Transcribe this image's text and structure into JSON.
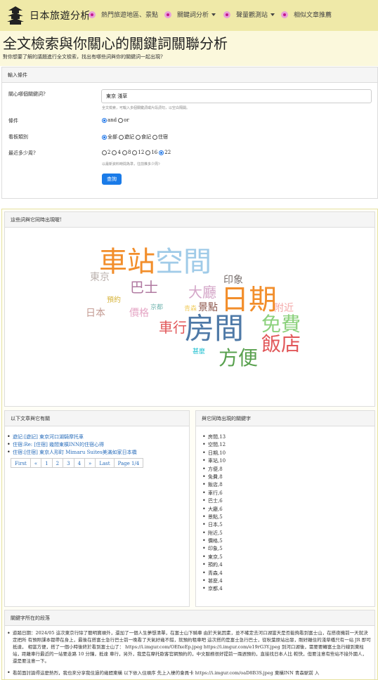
{
  "nav": {
    "brand": "日本旅遊分析",
    "items": [
      {
        "label": "熱門旅遊地區、景點",
        "dropdown": false
      },
      {
        "label": "關鍵詞分析",
        "dropdown": true
      },
      {
        "label": "聲量觀測站",
        "dropdown": true
      },
      {
        "label": "相似文章推薦",
        "dropdown": false
      }
    ]
  },
  "header": {
    "title": "全文檢索與你關心的關鍵詞關聯分析",
    "subtitle": "對你想要了解的議題進行全文檢索，找出有哪些詞與你的關鍵詞一起出現?"
  },
  "form": {
    "panel_title": "輸入條件",
    "keyword_label": "關心哪個關鍵詞?",
    "keyword_value": "東京 淺草",
    "keyword_help": "全文檢索，可輸入多個關鍵詞或片段詞句，以空白隔開。",
    "cond_label": "條件",
    "cond_options": [
      {
        "label": "and",
        "checked": true
      },
      {
        "label": "or",
        "checked": false
      }
    ],
    "board_label": "看板類別",
    "board_options": [
      {
        "label": "全部",
        "checked": true
      },
      {
        "label": "遊記",
        "checked": false
      },
      {
        "label": "食記",
        "checked": false
      },
      {
        "label": "住宿",
        "checked": false
      }
    ],
    "weeks_label": "最近多少周?",
    "weeks_options": [
      {
        "label": "2",
        "checked": false
      },
      {
        "label": "4",
        "checked": false
      },
      {
        "label": "8",
        "checked": false
      },
      {
        "label": "12",
        "checked": false
      },
      {
        "label": "16",
        "checked": false
      },
      {
        "label": "22",
        "checked": true
      }
    ],
    "weeks_help": "以最新資料時間為準，往前推多少周?",
    "submit_label": "查詢"
  },
  "cloud": {
    "panel_title": "這些詞與它同時出現喔!",
    "words": [
      {
        "text": "車站",
        "color": "#f28e2b"
      },
      {
        "text": "空間",
        "color": "#a0cbe8"
      },
      {
        "text": "東京",
        "color": "#bab0ac"
      },
      {
        "text": "巴士",
        "color": "#b07aa1"
      },
      {
        "text": "印象",
        "color": "#79706e"
      },
      {
        "text": "大廳",
        "color": "#d4a6c8"
      },
      {
        "text": "預約",
        "color": "#d7b53e"
      },
      {
        "text": "京都",
        "color": "#76b7b2"
      },
      {
        "text": "景點",
        "color": "#8c564b"
      },
      {
        "text": "日期",
        "color": "#f28e2b"
      },
      {
        "text": "附近",
        "color": "#f4a8a8"
      },
      {
        "text": "日本",
        "color": "#c49c94"
      },
      {
        "text": "價格",
        "color": "#e5a6c5"
      },
      {
        "text": "青森",
        "color": "#f1ce63"
      },
      {
        "text": "車行",
        "color": "#e15759"
      },
      {
        "text": "房間",
        "color": "#4e79a7"
      },
      {
        "text": "免費",
        "color": "#8cd17d"
      },
      {
        "text": "飯店",
        "color": "#e15759"
      },
      {
        "text": "甚麼",
        "color": "#17becf"
      },
      {
        "text": "方便",
        "color": "#59a14f"
      }
    ]
  },
  "articles": {
    "panel_title": "以下文章與它有關",
    "items": [
      "遊記:[遊記] 東京河口湖騎摩托車",
      "住宿:Re: [住宿] 幾間東橫INN的住宿心得",
      "住宿:[住宿] 東京人形町 Mimaru Suites美滿如家日本橋"
    ],
    "pager": [
      "First",
      "«",
      "1",
      "2",
      "3",
      "4",
      "»",
      "Last",
      "Page 1/4"
    ]
  },
  "keywords": {
    "panel_title": "與它同時出現的關鍵字",
    "items": [
      "房間,13",
      "空間,12",
      "日期,10",
      "車站,10",
      "方便,8",
      "免費,8",
      "飯店,8",
      "車行,6",
      "巴士,6",
      "大廳,6",
      "景點,5",
      "日本,5",
      "附近,5",
      "價格,5",
      "印象,5",
      "東京,5",
      "預約,4",
      "青森,4",
      "甚麼,4",
      "京都,4"
    ]
  },
  "paragraphs": {
    "panel_title": "關鍵字所在的段落",
    "items": [
      "遊踏日期：2024/05 這次東京行除了聽明寶順外，還加了一個人生夢想清單，在富士山下騎車 由於天氣因素，並不確定去河口湖當天是否能夠看到富士山，在搭夜機前一天就決定把所 有預照課本都帶在身上，最後在搭富士急行巴士前一晚看了天氣好幾不錯，就預約租車吧 這次搭的是富士急行巴士，從秋葉原站出發，剛好離住的淺草橋只有一站 JR 即可抵達， 相當方便，搭了一個小時後終於看到富士山了： https://i.imgur.com/OEfxeEp.jpeg https://i.imgur.com/e19rG3Y.jpeg 到河口湖後，需要要轉富士急行線到東柱站，距離車行最近的一站要走路 10 分鐘，抵達 車行，另外，我是在摩托歐客官網預約的，中文服務很好提前一兩週預約，直接找日本人比 較快，但要注意有些站不接外國人，還是要注意一下。",
      "看前面討論得這麼熱烈，我也來分享我住過的幾間東橫 以下依入住順序 先上入棲的會員卡 https://i.imgur.com/oaD8B3S.jpeg 東橫INN 青森駅前 入"
    ]
  }
}
